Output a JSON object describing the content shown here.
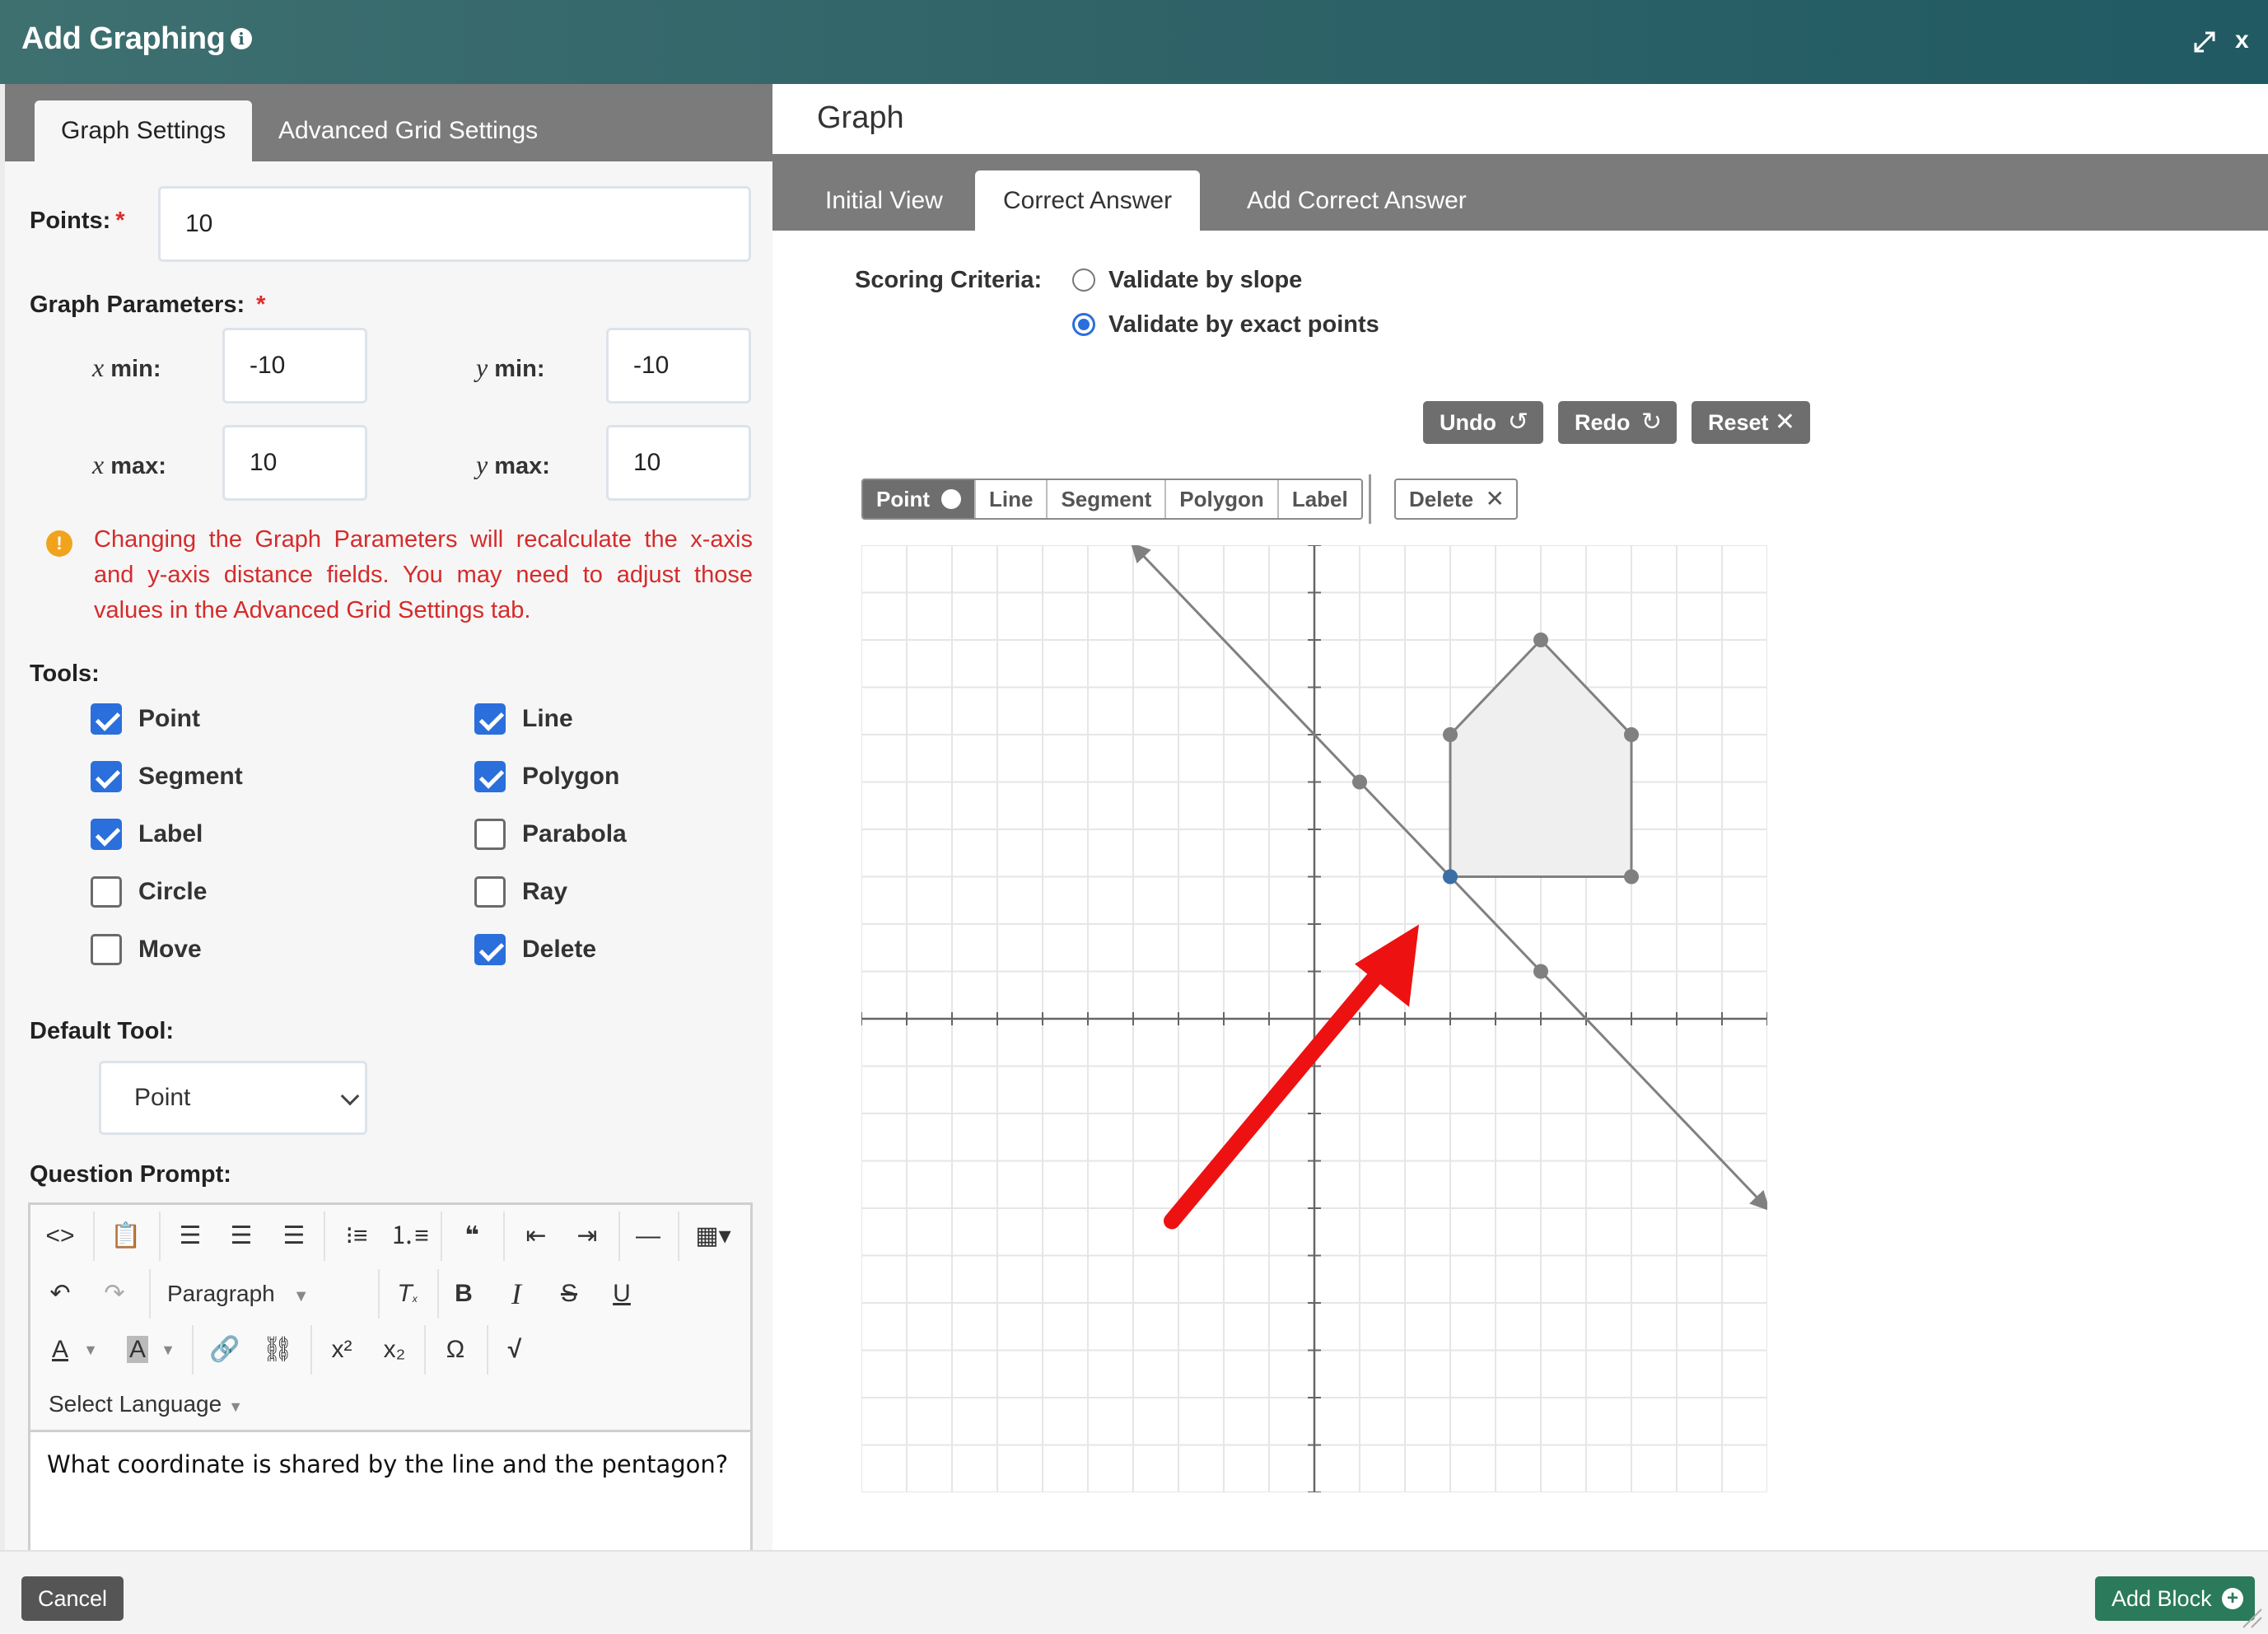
{
  "header": {
    "title": "Add Graphing",
    "close_label": "x"
  },
  "left_tabs": [
    {
      "label": "Graph Settings",
      "active": true
    },
    {
      "label": "Advanced Grid Settings",
      "active": false
    }
  ],
  "settings": {
    "points_label": "Points:",
    "points_value": "10",
    "graph_params_label": "Graph Parameters:",
    "required_mark": "*",
    "x_min_label": "min:",
    "x_min_value": "-10",
    "y_min_label": "min:",
    "y_min_value": "-10",
    "x_max_label": "max:",
    "x_max_value": "10",
    "y_max_label": "max:",
    "y_max_value": "10",
    "x_var": "x",
    "y_var": "y",
    "warning": "Changing the Graph Parameters will recalculate the x-axis and y-axis distance fields. You may need to adjust those values in the Advanced Grid Settings tab.",
    "tools_label": "Tools:",
    "tools": [
      {
        "label": "Point",
        "checked": true
      },
      {
        "label": "Line",
        "checked": true
      },
      {
        "label": "Segment",
        "checked": true
      },
      {
        "label": "Polygon",
        "checked": true
      },
      {
        "label": "Label",
        "checked": true
      },
      {
        "label": "Parabola",
        "checked": false
      },
      {
        "label": "Circle",
        "checked": false
      },
      {
        "label": "Ray",
        "checked": false
      },
      {
        "label": "Move",
        "checked": false
      },
      {
        "label": "Delete",
        "checked": true
      }
    ],
    "default_tool_label": "Default Tool:",
    "default_tool_value": "Point",
    "question_prompt_label": "Question Prompt:"
  },
  "editor": {
    "paragraph_label": "Paragraph",
    "language_label": "Select Language",
    "content": "What coordinate is shared by the line and the pentagon?"
  },
  "graph_panel": {
    "title": "Graph",
    "tabs": [
      {
        "label": "Initial View",
        "active": false
      },
      {
        "label": "Correct Answer",
        "active": true
      },
      {
        "label": "Add Correct Answer",
        "active": false
      }
    ],
    "scoring_label": "Scoring Criteria:",
    "scoring_options": [
      {
        "label": "Validate by slope",
        "selected": false
      },
      {
        "label": "Validate by exact points",
        "selected": true
      }
    ],
    "undo_label": "Undo",
    "redo_label": "Redo",
    "reset_label": "Reset",
    "tool_buttons": [
      "Point",
      "Line",
      "Segment",
      "Polygon",
      "Label"
    ],
    "active_tool": "Point",
    "delete_label": "Delete"
  },
  "graph": {
    "xlim": [
      -10,
      10
    ],
    "ylim": [
      -10,
      10
    ],
    "line_points": [
      [
        1,
        5
      ],
      [
        5,
        1
      ]
    ],
    "polygon": [
      [
        3,
        3
      ],
      [
        3,
        6
      ],
      [
        5,
        8
      ],
      [
        7,
        6
      ],
      [
        7,
        3
      ]
    ],
    "selected_point": [
      3,
      3
    ],
    "colors": {
      "grid": "#e6e6e6",
      "axis": "#666666",
      "shape": "#808080",
      "fill": "#efefef",
      "selected": "#3a6ea5",
      "arrow": "#ee1111"
    }
  },
  "footer": {
    "cancel_label": "Cancel",
    "add_block_label": "Add Block"
  }
}
